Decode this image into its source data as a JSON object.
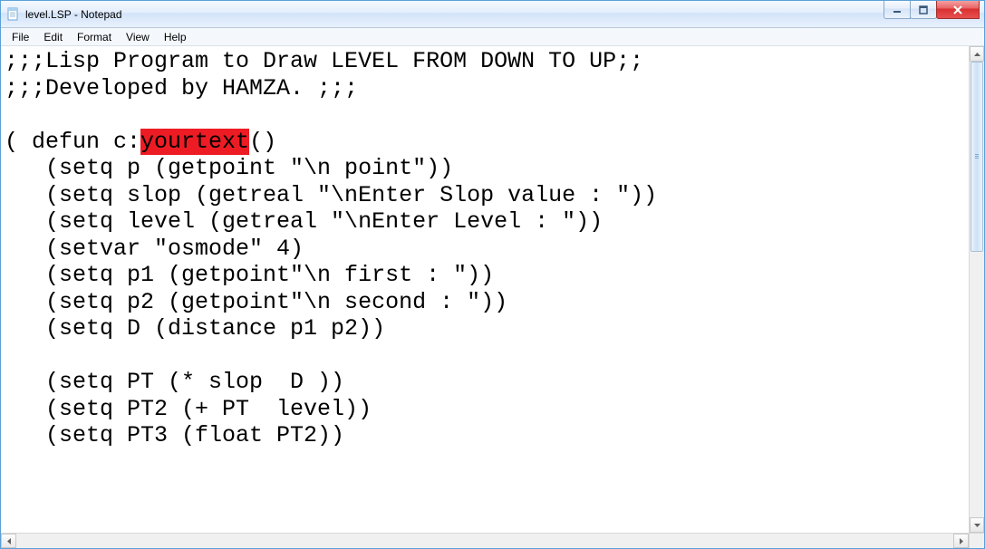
{
  "window": {
    "title": "level.LSP - Notepad"
  },
  "menu": {
    "file": "File",
    "edit": "Edit",
    "format": "Format",
    "view": "View",
    "help": "Help"
  },
  "editor": {
    "line1": ";;;Lisp Program to Draw LEVEL FROM DOWN TO UP;;",
    "line2": ";;;Developed by HAMZA. ;;;",
    "line3": "",
    "line4a": "( defun c:",
    "line4_hl": "yourtext",
    "line4b": "()",
    "line5": "   (setq p (getpoint \"\\n point\"))",
    "line6": "   (setq slop (getreal \"\\nEnter Slop value : \"))",
    "line7": "   (setq level (getreal \"\\nEnter Level : \"))",
    "line8": "   (setvar \"osmode\" 4)",
    "line9": "   (setq p1 (getpoint\"\\n first : \"))",
    "line10": "   (setq p2 (getpoint\"\\n second : \"))",
    "line11": "   (setq D (distance p1 p2))",
    "line12": "",
    "line13": "   (setq PT (* slop  D ))",
    "line14": "   (setq PT2 (+ PT  level))",
    "line15": "   (setq PT3 (float PT2))"
  },
  "icons": {
    "app": "notepad-icon",
    "min": "minimize-icon",
    "max": "maximize-icon",
    "close": "close-icon"
  }
}
